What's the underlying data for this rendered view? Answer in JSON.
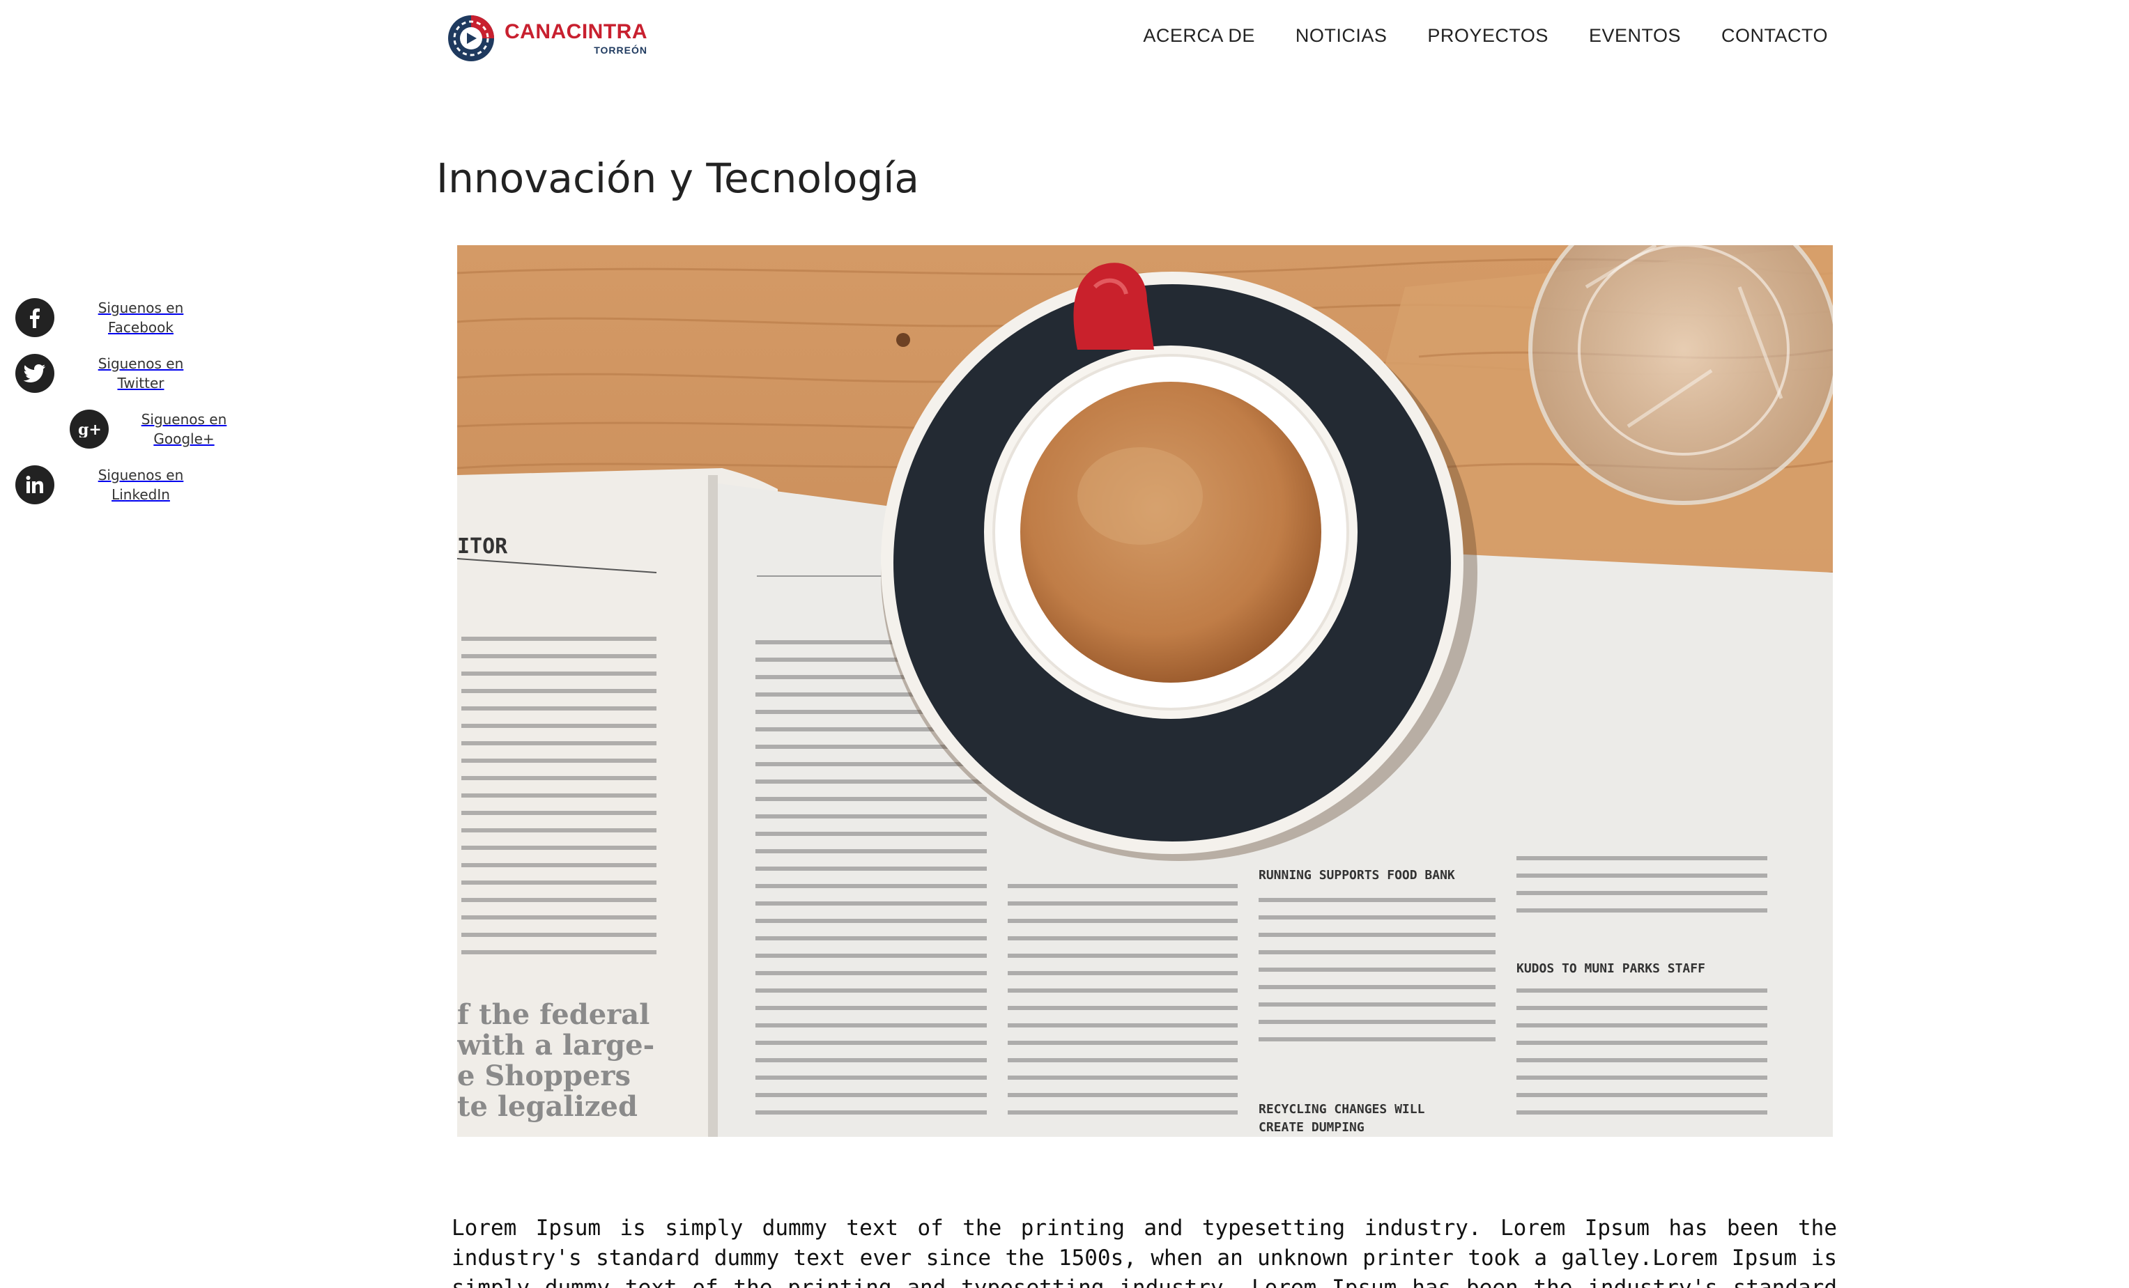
{
  "brand": {
    "name": "CANACINTRA",
    "subname": "TORREÓN"
  },
  "nav": {
    "items": [
      {
        "label": "ACERCA DE"
      },
      {
        "label": "NOTICIAS"
      },
      {
        "label": "PROYECTOS"
      },
      {
        "label": "EVENTOS"
      },
      {
        "label": "CONTACTO"
      }
    ]
  },
  "social": {
    "items": [
      {
        "label": "Siguenos en Facebook",
        "icon": "facebook-icon"
      },
      {
        "label": "Siguenos en Twitter",
        "icon": "twitter-icon"
      },
      {
        "label": "Siguenos en Google+",
        "icon": "google-plus-icon"
      },
      {
        "label": "Siguenos en LinkedIn",
        "icon": "linkedin-icon"
      }
    ]
  },
  "main": {
    "title": "Innovación y Tecnología",
    "body": "Lorem Ipsum is simply dummy text of the printing and typesetting industry. Lorem Ipsum has been the industry's standard dummy text ever since the 1500s, when an unknown printer took a galley.Lorem Ipsum is simply dummy text of the printing and typesetting industry. Lorem Ipsum has been the industry's standard dummy text ever since the 1500s, when an unknown printer took a"
  },
  "hero_image": {
    "newspaper_headers": [
      "ITOR",
      "RUNNING SUPPORTS FOOD BANK",
      "KUDOS TO MUNI PARKS STAFF",
      "RECYCLING CHANGES WILL",
      "CREATE DUMPING"
    ],
    "pull_quote": [
      "f the federal",
      "with a large-",
      "e Shoppers",
      "te legalized"
    ]
  },
  "colors": {
    "brand_red": "#c8202f",
    "brand_navy": "#1f3a5f",
    "text": "#222222",
    "icon_bg": "#222222"
  }
}
